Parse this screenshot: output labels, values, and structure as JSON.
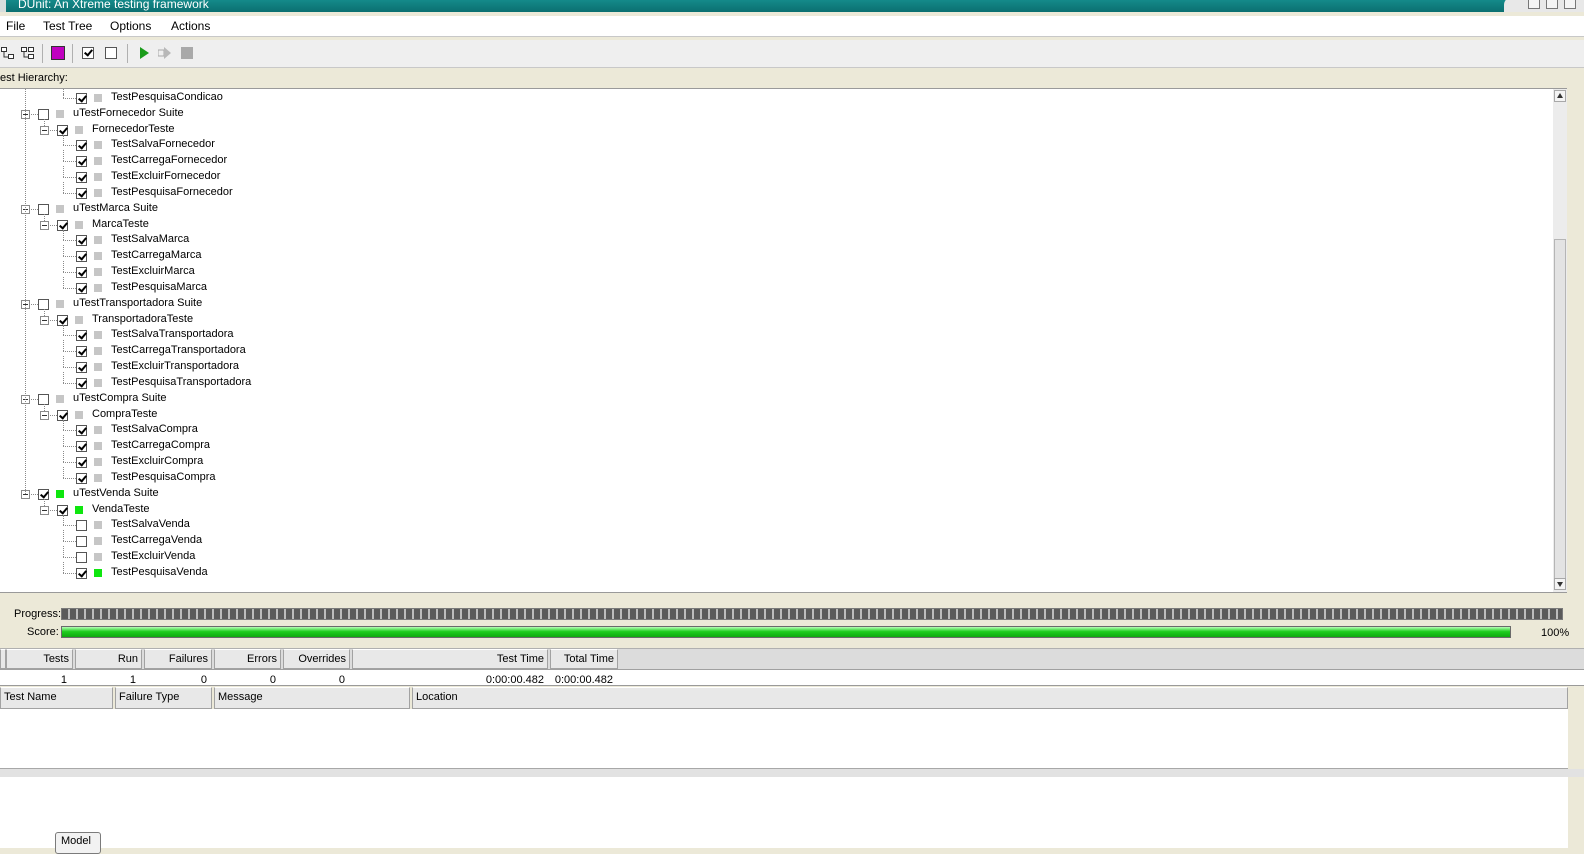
{
  "window": {
    "title": "DUnit: An Xtreme testing framework"
  },
  "menu": [
    "File",
    "Test Tree",
    "Options",
    "Actions"
  ],
  "toolbar": {
    "icons": [
      "select-all-icon",
      "deselect-all-icon",
      "select-failed-icon",
      "check-icon",
      "uncheck-icon",
      "run-icon",
      "run-selected-icon",
      "stop-icon"
    ]
  },
  "hierarchy_label": "est Hierarchy:",
  "tree": [
    {
      "label": "TestPesquisaCondicao",
      "level": 3,
      "checked": true,
      "status": "gray",
      "expander": false
    },
    {
      "label": "uTestFornecedor Suite",
      "level": 1,
      "checked": false,
      "status": "gray",
      "expander": true
    },
    {
      "label": "FornecedorTeste",
      "level": 2,
      "checked": true,
      "status": "gray",
      "expander": true
    },
    {
      "label": "TestSalvaFornecedor",
      "level": 3,
      "checked": true,
      "status": "gray",
      "expander": false
    },
    {
      "label": "TestCarregaFornecedor",
      "level": 3,
      "checked": true,
      "status": "gray",
      "expander": false
    },
    {
      "label": "TestExcluirFornecedor",
      "level": 3,
      "checked": true,
      "status": "gray",
      "expander": false
    },
    {
      "label": "TestPesquisaFornecedor",
      "level": 3,
      "checked": true,
      "status": "gray",
      "expander": false
    },
    {
      "label": "uTestMarca Suite",
      "level": 1,
      "checked": false,
      "status": "gray",
      "expander": true
    },
    {
      "label": "MarcaTeste",
      "level": 2,
      "checked": true,
      "status": "gray",
      "expander": true
    },
    {
      "label": "TestSalvaMarca",
      "level": 3,
      "checked": true,
      "status": "gray",
      "expander": false
    },
    {
      "label": "TestCarregaMarca",
      "level": 3,
      "checked": true,
      "status": "gray",
      "expander": false
    },
    {
      "label": "TestExcluirMarca",
      "level": 3,
      "checked": true,
      "status": "gray",
      "expander": false
    },
    {
      "label": "TestPesquisaMarca",
      "level": 3,
      "checked": true,
      "status": "gray",
      "expander": false
    },
    {
      "label": "uTestTransportadora Suite",
      "level": 1,
      "checked": false,
      "status": "gray",
      "expander": true
    },
    {
      "label": "TransportadoraTeste",
      "level": 2,
      "checked": true,
      "status": "gray",
      "expander": true
    },
    {
      "label": "TestSalvaTransportadora",
      "level": 3,
      "checked": true,
      "status": "gray",
      "expander": false
    },
    {
      "label": "TestCarregaTransportadora",
      "level": 3,
      "checked": true,
      "status": "gray",
      "expander": false
    },
    {
      "label": "TestExcluirTransportadora",
      "level": 3,
      "checked": true,
      "status": "gray",
      "expander": false
    },
    {
      "label": "TestPesquisaTransportadora",
      "level": 3,
      "checked": true,
      "status": "gray",
      "expander": false
    },
    {
      "label": "uTestCompra Suite",
      "level": 1,
      "checked": false,
      "status": "gray",
      "expander": true
    },
    {
      "label": "CompraTeste",
      "level": 2,
      "checked": true,
      "status": "gray",
      "expander": true
    },
    {
      "label": "TestSalvaCompra",
      "level": 3,
      "checked": true,
      "status": "gray",
      "expander": false
    },
    {
      "label": "TestCarregaCompra",
      "level": 3,
      "checked": true,
      "status": "gray",
      "expander": false
    },
    {
      "label": "TestExcluirCompra",
      "level": 3,
      "checked": true,
      "status": "gray",
      "expander": false
    },
    {
      "label": "TestPesquisaCompra",
      "level": 3,
      "checked": true,
      "status": "gray",
      "expander": false
    },
    {
      "label": "uTestVenda Suite",
      "level": 1,
      "checked": true,
      "status": "green",
      "expander": true
    },
    {
      "label": "VendaTeste",
      "level": 2,
      "checked": true,
      "status": "green",
      "expander": true
    },
    {
      "label": "TestSalvaVenda",
      "level": 3,
      "checked": false,
      "status": "gray",
      "expander": false
    },
    {
      "label": "TestCarregaVenda",
      "level": 3,
      "checked": false,
      "status": "gray",
      "expander": false
    },
    {
      "label": "TestExcluirVenda",
      "level": 3,
      "checked": false,
      "status": "gray",
      "expander": false
    },
    {
      "label": "TestPesquisaVenda",
      "level": 3,
      "checked": true,
      "status": "green",
      "expander": false
    }
  ],
  "progress": {
    "label": "Progress:",
    "fraction": 1.0
  },
  "score": {
    "label": "Score:",
    "fraction": 1.0,
    "text": "100%"
  },
  "stats": {
    "headers": [
      "Tests",
      "Run",
      "Failures",
      "Errors",
      "Overrides",
      "Test Time",
      "Total Time"
    ],
    "values": [
      "1",
      "1",
      "0",
      "0",
      "0",
      "0:00:00.482",
      "0:00:00.482"
    ]
  },
  "failures": {
    "headers": [
      "Test Name",
      "Failure Type",
      "Message",
      "Location"
    ]
  },
  "model_button": "Model",
  "colors": {
    "title": "#0b7f80",
    "pass": "#0ee60e",
    "not_run": "#c6c6c6",
    "score": "#1fce1f"
  }
}
